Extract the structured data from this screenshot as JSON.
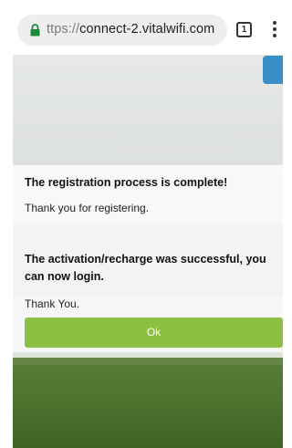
{
  "browser": {
    "url_scheme": "ttps://",
    "url_host": "connect-2.vitalwifi.com",
    "tab_count": "1",
    "icons": {
      "lock": "lock-icon",
      "tabs": "tab-count-icon",
      "menu": "overflow-menu-icon"
    }
  },
  "dialog": {
    "title": "The registration process is complete!",
    "thanks_registering": "Thank you for registering.",
    "activation_message": "The activation/recharge was successful, you can now login.",
    "thank_you": "Thank You.",
    "ok_label": "Ok"
  },
  "colors": {
    "lock": "#1a8a3a",
    "ok_button": "#8cc041",
    "corner_button": "#3a8fc8"
  }
}
